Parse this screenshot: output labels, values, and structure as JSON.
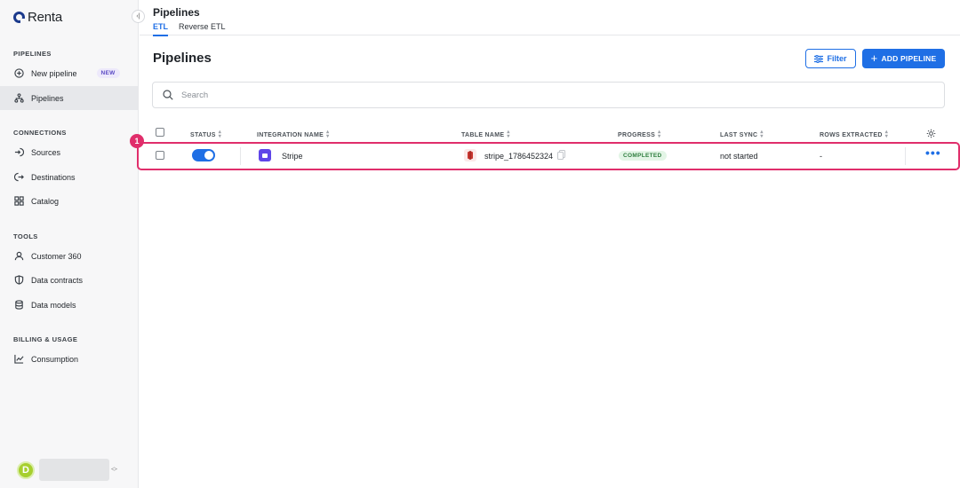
{
  "app": {
    "name": "Renta",
    "collapse_icon": "collapse-sidebar-icon"
  },
  "sidebar": {
    "sections": [
      {
        "title": "PIPELINES",
        "items": [
          {
            "label": "New pipeline",
            "icon": "plus-circle-icon",
            "badge": "NEW",
            "active": false
          },
          {
            "label": "Pipelines",
            "icon": "pipelines-icon",
            "active": true
          }
        ]
      },
      {
        "title": "CONNECTIONS",
        "items": [
          {
            "label": "Sources",
            "icon": "source-icon",
            "active": false
          },
          {
            "label": "Destinations",
            "icon": "destination-icon",
            "active": false
          },
          {
            "label": "Catalog",
            "icon": "catalog-icon",
            "active": false
          }
        ]
      },
      {
        "title": "TOOLS",
        "items": [
          {
            "label": "Customer 360",
            "icon": "user-icon",
            "active": false
          },
          {
            "label": "Data contracts",
            "icon": "shield-icon",
            "active": false
          },
          {
            "label": "Data models",
            "icon": "database-icon",
            "active": false
          }
        ]
      },
      {
        "title": "BILLING & USAGE",
        "items": [
          {
            "label": "Consumption",
            "icon": "chart-line-icon",
            "active": false
          }
        ]
      }
    ],
    "user": {
      "avatar_letter": "D",
      "avatar_color": "#a6cf2e"
    }
  },
  "header": {
    "title": "Pipelines",
    "tabs": [
      {
        "label": "ETL",
        "active": true
      },
      {
        "label": "Reverse ETL",
        "active": false
      }
    ]
  },
  "main": {
    "title": "Pipelines",
    "filter_label": "Filter",
    "add_label": "ADD PIPELINE",
    "search_placeholder": "Search",
    "search_value": "",
    "accent_color": "#1f6fe5",
    "table": {
      "columns": [
        "STATUS",
        "INTEGRATION NAME",
        "TABLE NAME",
        "PROGRESS",
        "LAST SYNC",
        "ROWS EXTRACTED"
      ],
      "rows": [
        {
          "checked": false,
          "status_on": true,
          "integration": "Stripe",
          "integration_icon": "stripe-logo-icon",
          "table_name": "stripe_1786452324",
          "table_icon": "redshift-icon",
          "progress": "COMPLETED",
          "last_sync": "not started",
          "rows_extracted": "-"
        }
      ]
    },
    "annotation_marker": "1",
    "highlight_color": "#e02e6b"
  }
}
